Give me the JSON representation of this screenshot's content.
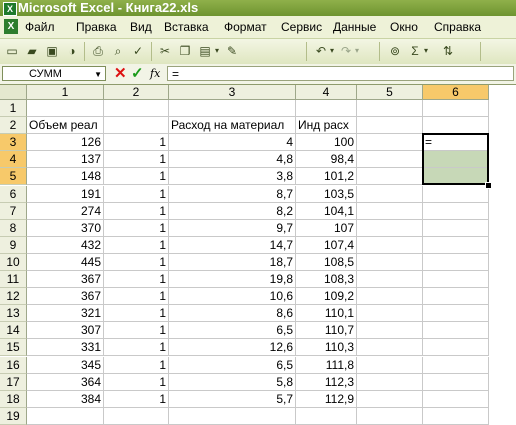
{
  "window": {
    "title": "Microsoft Excel - Книга22.xls"
  },
  "menu": [
    "Файл",
    "Правка",
    "Вид",
    "Вставка",
    "Формат",
    "Сервис",
    "Данные",
    "Окно",
    "Справка"
  ],
  "toolbar_icons": [
    "new-icon",
    "open-icon",
    "save-icon",
    "permission-icon",
    "print-icon",
    "print-preview-icon",
    "spelling-icon",
    "cut-icon",
    "copy-icon",
    "paste-icon",
    "format-painter-icon",
    "undo-icon",
    "redo-icon",
    "hyperlink-icon",
    "autosum-icon",
    "sort-ascending-icon"
  ],
  "formula_bar": {
    "name_box": "СУММ",
    "formula": "="
  },
  "columns": [
    "1",
    "2",
    "3",
    "4",
    "5",
    "6"
  ],
  "rows": [
    "1",
    "2",
    "3",
    "4",
    "5",
    "6",
    "7",
    "8",
    "9",
    "10",
    "11",
    "12",
    "13",
    "14",
    "15",
    "16",
    "17",
    "18",
    "19"
  ],
  "header_row": [
    "Объем реал",
    "",
    "Расход на материал",
    "Инд расх",
    "",
    ""
  ],
  "table": [
    [
      "126",
      "1",
      "4",
      "100"
    ],
    [
      "137",
      "1",
      "4,8",
      "98,4"
    ],
    [
      "148",
      "1",
      "3,8",
      "101,2"
    ],
    [
      "191",
      "1",
      "8,7",
      "103,5"
    ],
    [
      "274",
      "1",
      "8,2",
      "104,1"
    ],
    [
      "370",
      "1",
      "9,7",
      "107"
    ],
    [
      "432",
      "1",
      "14,7",
      "107,4"
    ],
    [
      "445",
      "1",
      "18,7",
      "108,5"
    ],
    [
      "367",
      "1",
      "19,8",
      "108,3"
    ],
    [
      "367",
      "1",
      "10,6",
      "109,2"
    ],
    [
      "321",
      "1",
      "8,6",
      "110,1"
    ],
    [
      "307",
      "1",
      "6,5",
      "110,7"
    ],
    [
      "331",
      "1",
      "12,6",
      "110,3"
    ],
    [
      "345",
      "1",
      "6,5",
      "111,8"
    ],
    [
      "364",
      "1",
      "5,8",
      "112,3"
    ],
    [
      "384",
      "1",
      "5,7",
      "112,9"
    ]
  ],
  "active_cell": {
    "value": "="
  }
}
